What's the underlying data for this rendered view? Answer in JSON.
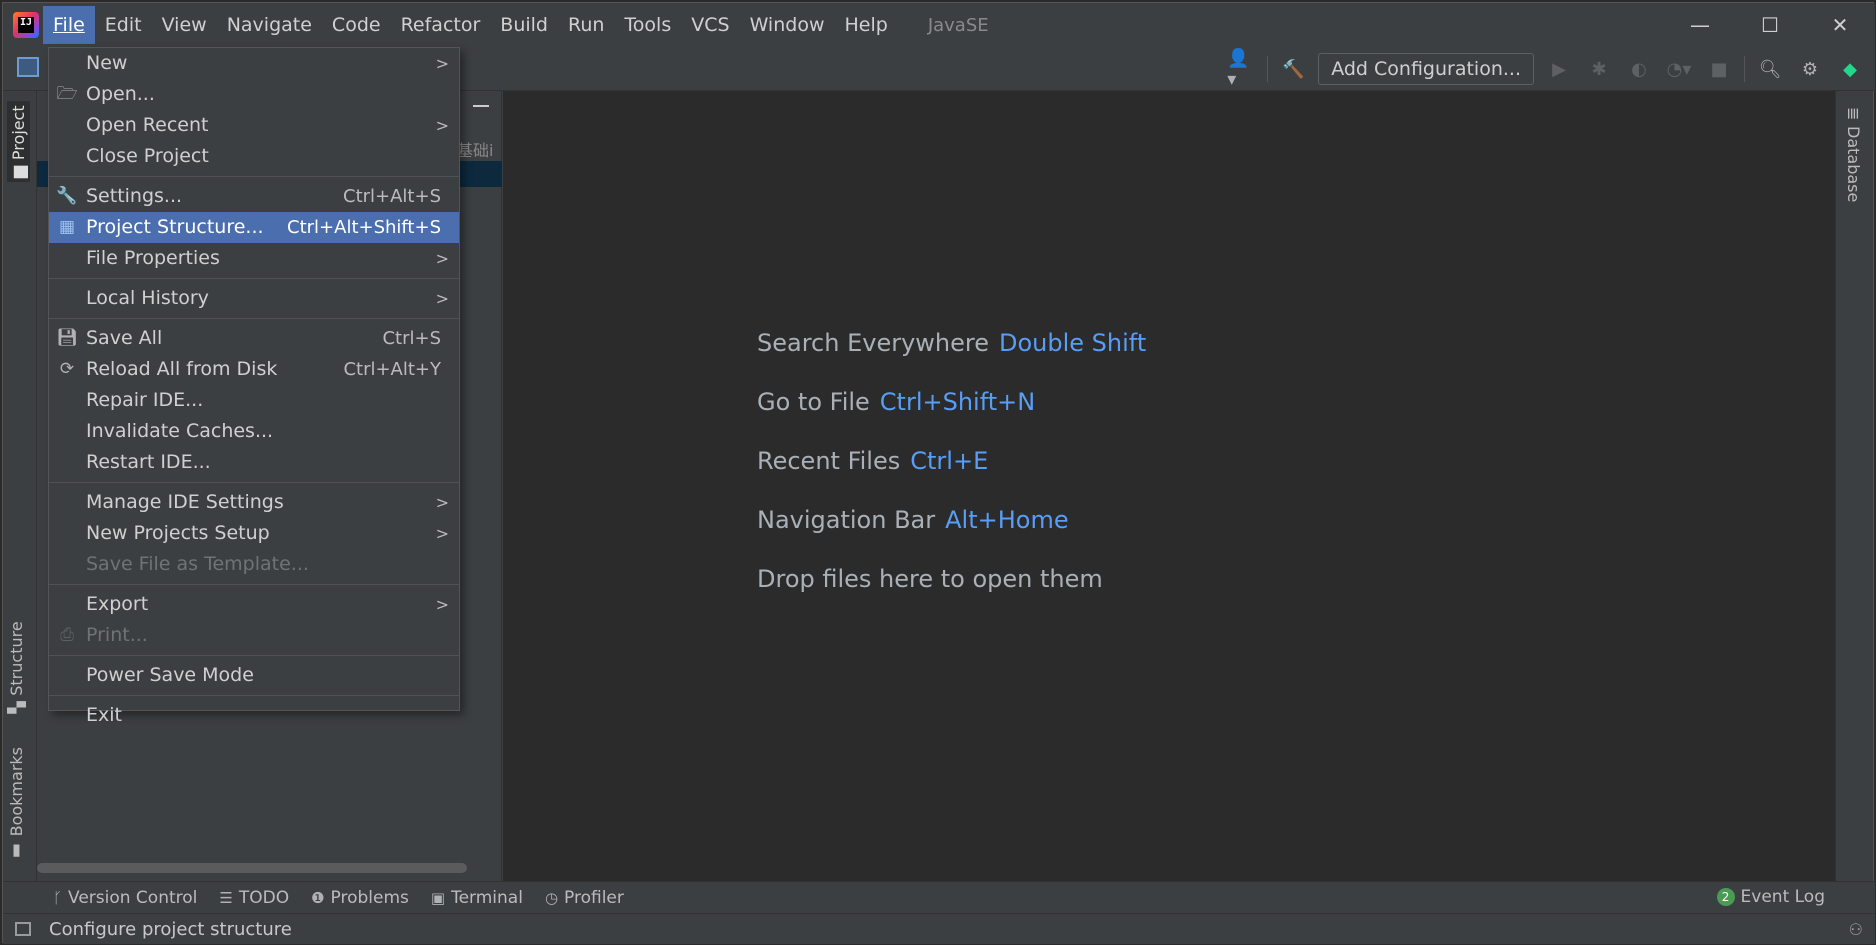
{
  "window": {
    "title": "JavaSE",
    "controls": [
      "—",
      "☐",
      "✕"
    ]
  },
  "menubar": [
    {
      "label": "File",
      "active": true
    },
    {
      "label": "Edit"
    },
    {
      "label": "View"
    },
    {
      "label": "Navigate"
    },
    {
      "label": "Code"
    },
    {
      "label": "Refactor"
    },
    {
      "label": "Build"
    },
    {
      "label": "Run"
    },
    {
      "label": "Tools"
    },
    {
      "label": "VCS"
    },
    {
      "label": "Window"
    },
    {
      "label": "Help"
    }
  ],
  "toolbar": {
    "add_config_label": "Add Configuration..."
  },
  "left_strip": {
    "project_tab": "Project",
    "structure_tab": "Structure",
    "bookmarks_tab": "Bookmarks"
  },
  "project_panel": {
    "partial_text": "基础i"
  },
  "right_strip": {
    "database_tab": "Database"
  },
  "file_menu": {
    "new": "New",
    "open": "Open...",
    "open_recent": "Open Recent",
    "close_project": "Close Project",
    "settings": "Settings...",
    "settings_sc": "Ctrl+Alt+S",
    "project_structure": "Project Structure...",
    "project_structure_sc": "Ctrl+Alt+Shift+S",
    "file_properties": "File Properties",
    "local_history": "Local History",
    "save_all": "Save All",
    "save_all_sc": "Ctrl+S",
    "reload": "Reload All from Disk",
    "reload_sc": "Ctrl+Alt+Y",
    "repair": "Repair IDE...",
    "invalidate": "Invalidate Caches...",
    "restart": "Restart IDE...",
    "manage_settings": "Manage IDE Settings",
    "new_projects_setup": "New Projects Setup",
    "save_template": "Save File as Template...",
    "export": "Export",
    "print": "Print...",
    "power_save": "Power Save Mode",
    "exit": "Exit"
  },
  "editor_hints": {
    "search_label": "Search Everywhere",
    "search_key": "Double Shift",
    "goto_label": "Go to File",
    "goto_key": "Ctrl+Shift+N",
    "recent_label": "Recent Files",
    "recent_key": "Ctrl+E",
    "nav_label": "Navigation Bar",
    "nav_key": "Alt+Home",
    "drop_label": "Drop files here to open them"
  },
  "bottom_tools": {
    "version_control": "Version Control",
    "todo": "TODO",
    "problems": "Problems",
    "terminal": "Terminal",
    "profiler": "Profiler",
    "event_log": "Event Log",
    "event_count": "2"
  },
  "status": {
    "message": "Configure project structure"
  },
  "colors": {
    "highlight": "#4b6eaf",
    "shortcut_blue": "#589df6",
    "panel_bg": "#3c3f41",
    "editor_bg": "#2b2b2b"
  }
}
